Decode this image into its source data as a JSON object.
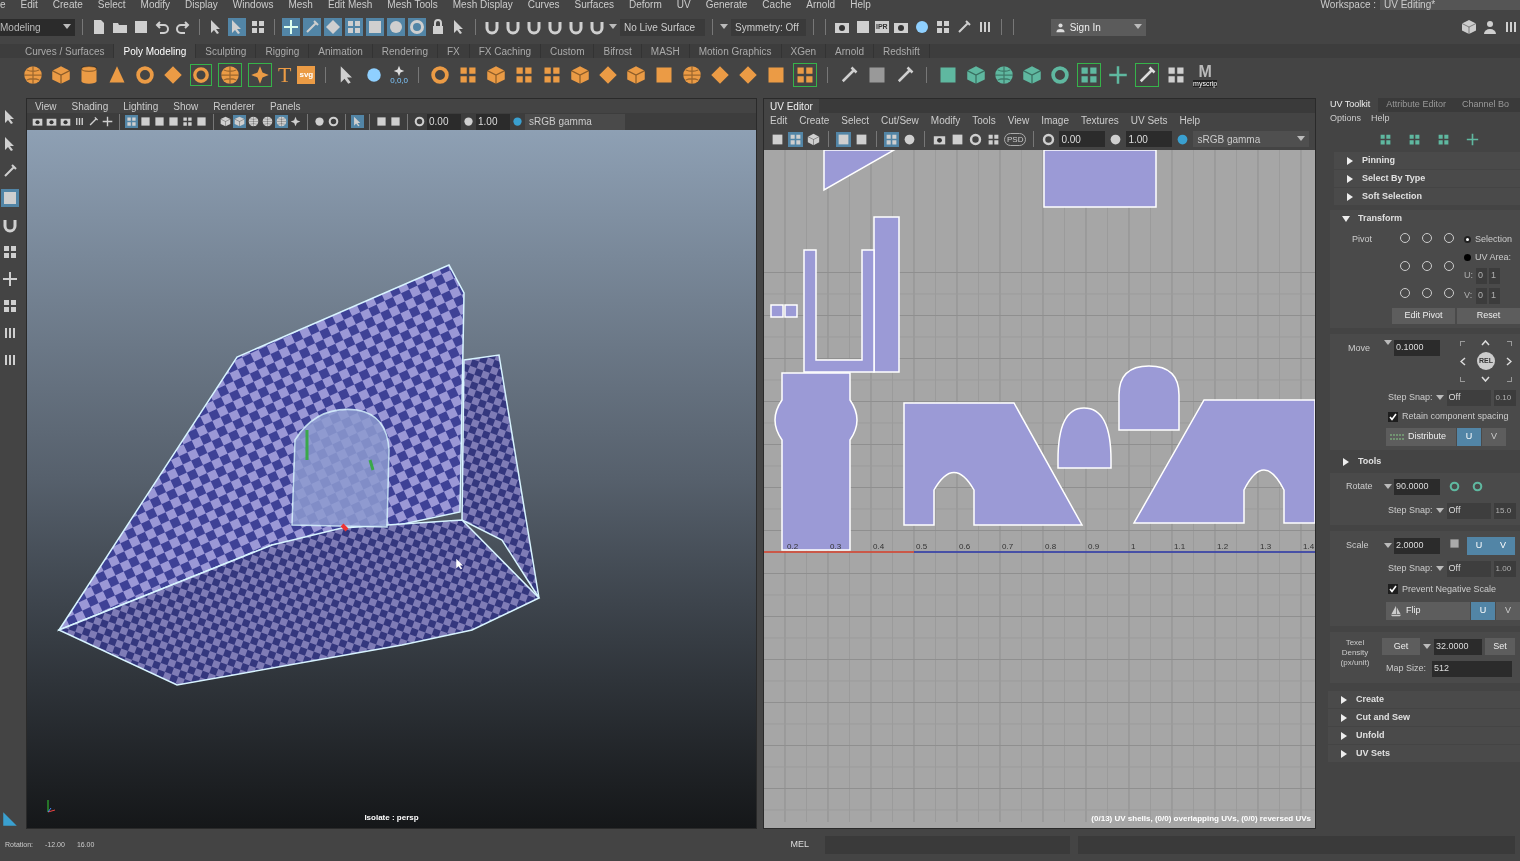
{
  "menu_bar": {
    "items": [
      "e",
      "Edit",
      "Create",
      "Select",
      "Modify",
      "Display",
      "Windows",
      "Mesh",
      "Edit Mesh",
      "Mesh Tools",
      "Mesh Display",
      "Curves",
      "Surfaces",
      "Deform",
      "UV",
      "Generate",
      "Cache",
      "Arnold",
      "Help"
    ],
    "workspace_label": "Workspace :",
    "workspace": "UV Editing*"
  },
  "status_line": {
    "mode": "Modeling",
    "live_surface": "No Live Surface",
    "symmetry": "Symmetry: Off",
    "render_icon_label": "IPR",
    "sign_in": "Sign In"
  },
  "shelf": {
    "tabs": [
      {
        "label": "Curves / Surfaces",
        "selected": false
      },
      {
        "label": "Poly Modeling",
        "selected": true
      },
      {
        "label": "Sculpting",
        "selected": false
      },
      {
        "label": "Rigging",
        "selected": false
      },
      {
        "label": "Animation",
        "selected": false
      },
      {
        "label": "Rendering",
        "selected": false
      },
      {
        "label": "FX",
        "selected": false
      },
      {
        "label": "FX Caching",
        "selected": false
      },
      {
        "label": "Custom",
        "selected": false
      },
      {
        "label": "Bifrost",
        "selected": false
      },
      {
        "label": "MASH",
        "selected": false
      },
      {
        "label": "Motion Graphics",
        "selected": false
      },
      {
        "label": "XGen",
        "selected": false
      },
      {
        "label": "Arnold",
        "selected": false
      },
      {
        "label": "Redshift",
        "selected": false
      }
    ],
    "text_icons": [
      "T",
      "svg",
      "0,0,0"
    ],
    "script_icon": {
      "letter": "M",
      "caption": "myscrip"
    }
  },
  "viewport": {
    "menu": [
      "View",
      "Shading",
      "Lighting",
      "Show",
      "Renderer",
      "Panels"
    ],
    "exposure": "0.00",
    "gamma": "1.00",
    "color_space": "sRGB gamma",
    "camera_label": "Isolate : persp"
  },
  "uv_editor": {
    "title": "UV Editor",
    "menu": [
      "Edit",
      "Create",
      "Select",
      "Cut/Sew",
      "Modify",
      "Tools",
      "View",
      "Image",
      "Textures",
      "UV Sets",
      "Help"
    ],
    "psd_label": "PSD",
    "exposure": "0.00",
    "gamma": "1.00",
    "color_space": "sRGB gamma",
    "axis_labels": [
      "0.2",
      "0.3",
      "0.4",
      "0.5",
      "0.6",
      "0.7",
      "0.8",
      "0.9",
      "1",
      "1.1",
      "1.2",
      "1.3",
      "1.4"
    ],
    "info": "(0/13) UV shells, (0/0) overlapping UVs, (0/0) reversed UVs"
  },
  "uv_toolkit": {
    "tabs": [
      {
        "label": "UV Toolkit",
        "selected": true
      },
      {
        "label": "Attribute Editor",
        "selected": false
      },
      {
        "label": "Channel Bo",
        "selected": false
      }
    ],
    "menu": [
      "Options",
      "Help"
    ],
    "sections_top": [
      {
        "label": "Pinning",
        "expanded": false
      },
      {
        "label": "Select By Type",
        "expanded": false
      },
      {
        "label": "Soft Selection",
        "expanded": false
      }
    ],
    "transform": {
      "label": "Transform",
      "expanded": true,
      "pivot": {
        "label": "Pivot",
        "points": [
          {
            "selected": false
          },
          {
            "selected": false
          },
          {
            "selected": false
          },
          {
            "selected": false
          },
          {
            "selected": false
          },
          {
            "selected": false
          },
          {
            "selected": false
          },
          {
            "selected": false
          },
          {
            "selected": false
          }
        ],
        "options": [
          {
            "label": "Selection",
            "selected": true
          },
          {
            "label": "UV Area:",
            "selected": false
          }
        ],
        "u_label": "U:",
        "v_label": "V:",
        "u_values": [
          "0",
          "1"
        ],
        "v_values": [
          "0",
          "1"
        ],
        "buttons": [
          "Edit Pivot",
          "Reset"
        ]
      },
      "move": {
        "label": "Move",
        "value": "0.1000",
        "center": "REL",
        "step_snap_label": "Step Snap:",
        "step_snap": "Off",
        "step_value": "0.10",
        "retain": {
          "label": "Retain component spacing",
          "checked": true
        },
        "distribute": {
          "label": "Distribute",
          "u": {
            "label": "U",
            "selected": true
          },
          "v": {
            "label": "V",
            "selected": false
          }
        }
      },
      "tools": {
        "label": "Tools",
        "expanded": false
      },
      "rotate": {
        "label": "Rotate",
        "value": "90.0000",
        "step_snap_label": "Step Snap:",
        "step_snap": "Off",
        "step_value": "15.0"
      },
      "scale": {
        "label": "Scale",
        "value": "2.0000",
        "u": {
          "label": "U",
          "selected": true
        },
        "v": {
          "label": "V",
          "selected": true
        },
        "step_snap_label": "Step Snap:",
        "step_snap": "Off",
        "step_value": "1.00",
        "prevent_negative": {
          "label": "Prevent Negative Scale",
          "checked": true
        },
        "flip": {
          "label": "Flip",
          "u": {
            "label": "U",
            "selected": true
          },
          "v": {
            "label": "V",
            "selected": false
          }
        }
      },
      "texel": {
        "label": "Texel Density (px/unit)",
        "get": "Get",
        "value": "32.0000",
        "set": "Set",
        "map_size_label": "Map Size:",
        "map_size": "512"
      }
    },
    "sections_bottom": [
      {
        "label": "Create",
        "expanded": false
      },
      {
        "label": "Cut and Sew",
        "expanded": false
      },
      {
        "label": "Unfold",
        "expanded": false
      },
      {
        "label": "UV Sets",
        "expanded": false
      }
    ]
  },
  "status_bar": {
    "rotation_label": "Rotation:",
    "rotation_values": [
      "-12.00",
      "16.00"
    ],
    "command_language": "MEL"
  }
}
